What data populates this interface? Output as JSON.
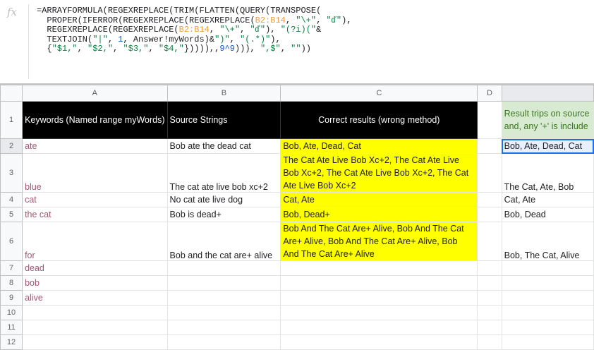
{
  "formula_bar": {
    "fx_label": "fx",
    "parts": {
      "p1": "=ARRAYFORMULA(REGEXREPLACE(TRIM(FLATTEN(QUERY(TRANSPOSE(\n  PROPER(IFERROR(REGEXREPLACE(REGEXREPLACE(",
      "r1": "B2:B14",
      "p2": ", ",
      "s1": "\"\\+\"",
      "p3": ", ",
      "s2": "\"ď\"",
      "p4": "),\n  REGEXREPLACE(REGEXREPLACE(",
      "r2": "B2:B14",
      "p5": ", ",
      "s3": "\"\\+\"",
      "p6": ", ",
      "s4": "\"ď\"",
      "p7": "), ",
      "s5": "\"(?i)(\"",
      "p8": "&\n  TEXTJOIN(",
      "s6": "\"|\"",
      "p9": ", ",
      "n1": "1",
      "p10": ", Answer!myWords)&",
      "s7": "\")\"",
      "p11": ", ",
      "s8": "\"(.*)\"",
      "p12": "),\n  {",
      "s9": "\"$1,\"",
      "p13": ", ",
      "s10": "\"$2,\"",
      "p14": ", ",
      "s11": "\"$3,\"",
      "p15": ", ",
      "s12": "\"$4,\"",
      "p16": "})))),,",
      "n2": "9^9",
      "p17": "))), ",
      "s13": "\",$\"",
      "p18": ", ",
      "s14": "\"\"",
      "p19": "))"
    }
  },
  "columns": [
    "A",
    "B",
    "C",
    "D",
    ""
  ],
  "header": {
    "a": "Keywords (Named range myWords)",
    "b": "Source Strings",
    "c": "Correct results (wrong method)",
    "e": "Result trips on source and, any '+' is include"
  },
  "rows": [
    {
      "num": "2",
      "a": "ate",
      "b": "Bob ate the dead cat",
      "c": "Bob, Ate, Dead, Cat",
      "e": "Bob, Ate, Dead, Cat"
    },
    {
      "num": "3",
      "a": "blue",
      "b": "The cat ate live bob xc+2",
      "c": "The Cat Ate Live Bob Xc+2, The Cat Ate Live Bob Xc+2, The Cat Ate Live Bob Xc+2, The Cat Ate Live Bob Xc+2",
      "e": "The Cat, Ate, Bob"
    },
    {
      "num": "4",
      "a": "cat",
      "b": "No cat ate live dog",
      "c": "Cat, Ate",
      "e": "Cat, Ate"
    },
    {
      "num": "5",
      "a": "the cat",
      "b": "Bob is dead+",
      "c": "Bob, Dead+",
      "e": "Bob, Dead"
    },
    {
      "num": "6",
      "a": "for",
      "b": "Bob and the cat are+ alive",
      "c": "Bob And The Cat Are+ Alive, Bob And The Cat Are+ Alive, Bob And The Cat Are+ Alive, Bob And The Cat Are+ Alive",
      "e": "Bob, The Cat, Alive"
    },
    {
      "num": "7",
      "a": "dead"
    },
    {
      "num": "8",
      "a": "bob"
    },
    {
      "num": "9",
      "a": "alive"
    },
    {
      "num": "10"
    },
    {
      "num": "11"
    },
    {
      "num": "12"
    }
  ],
  "colors": {
    "highlight_yellow": "#ffff00",
    "header_black": "#000000",
    "result_green": "#d9ead3",
    "selection_blue": "#1a73e8"
  }
}
